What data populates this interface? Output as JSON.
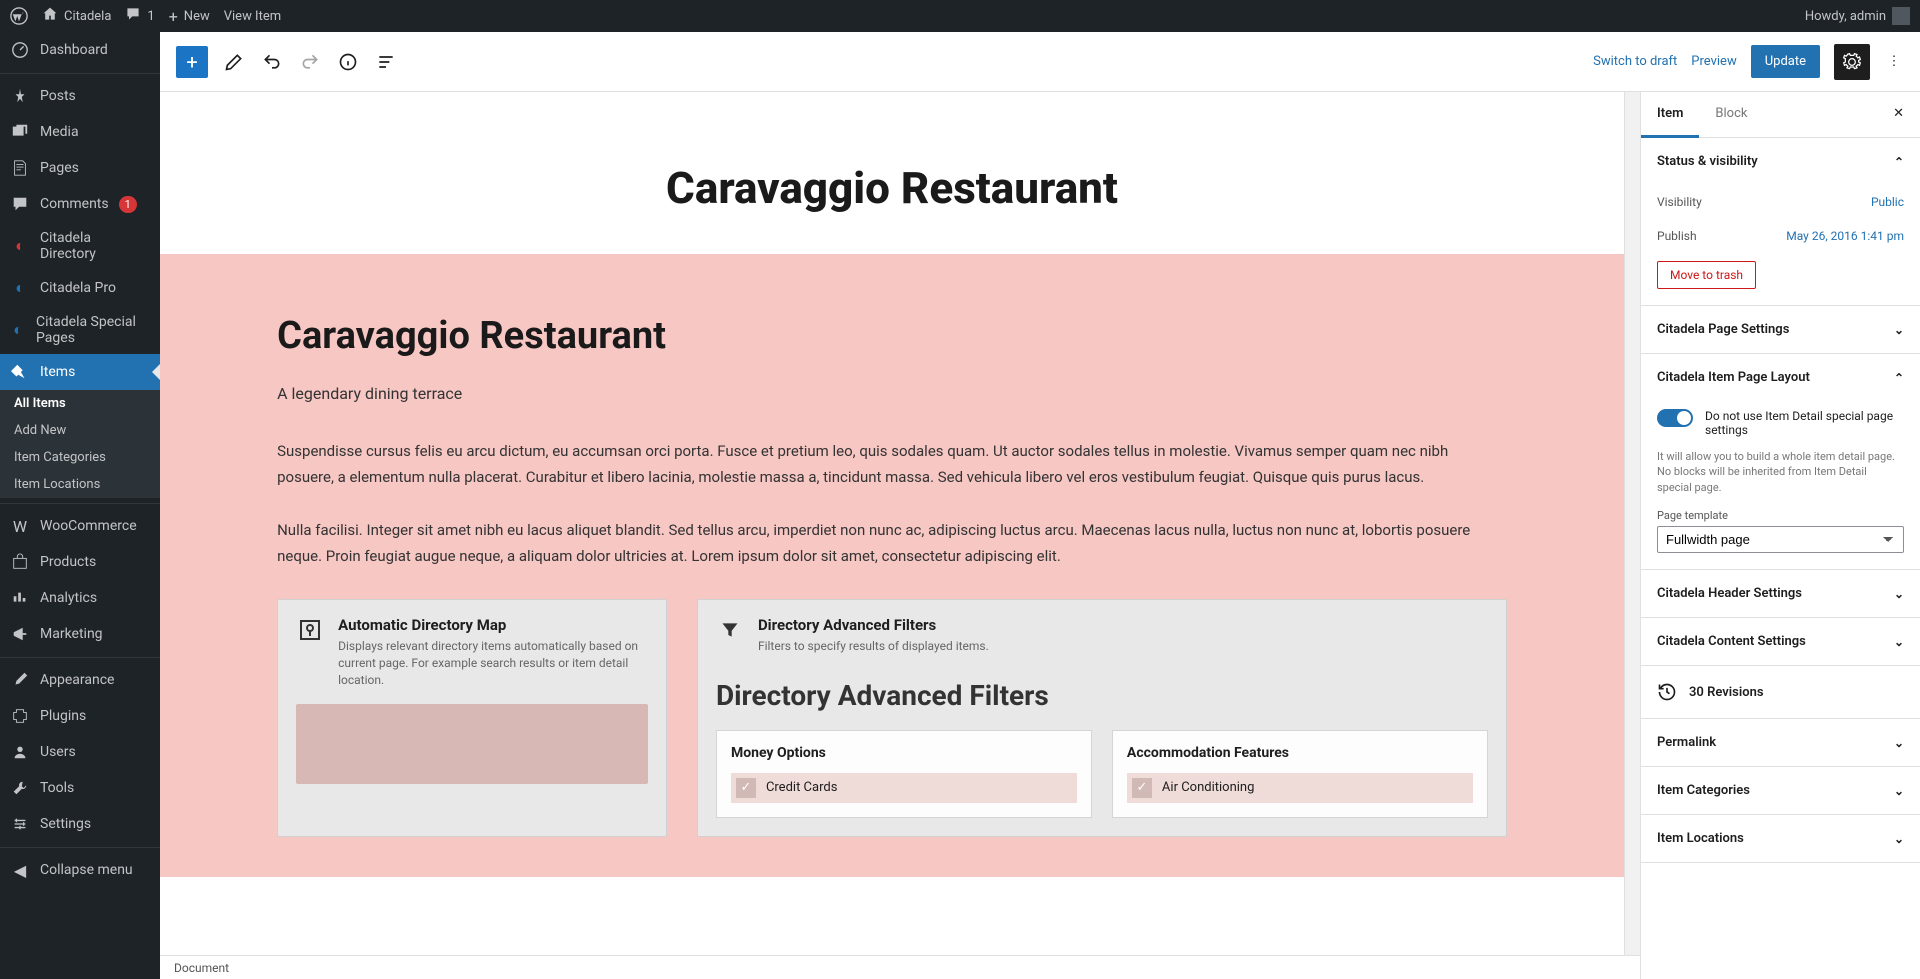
{
  "adminBar": {
    "siteName": "Citadela",
    "commentCount": "1",
    "newLabel": "New",
    "viewItem": "View Item",
    "greeting": "Howdy, admin"
  },
  "sidebar": {
    "items": [
      {
        "icon": "dashboard",
        "label": "Dashboard"
      },
      {
        "icon": "pin",
        "label": "Posts"
      },
      {
        "icon": "media",
        "label": "Media"
      },
      {
        "icon": "pages",
        "label": "Pages"
      },
      {
        "icon": "comments",
        "label": "Comments",
        "badge": "1"
      },
      {
        "icon": "citadela",
        "label": "Citadela Directory"
      },
      {
        "icon": "citadela",
        "label": "Citadela Pro"
      },
      {
        "icon": "citadela",
        "label": "Citadela Special Pages"
      },
      {
        "icon": "pin",
        "label": "Items",
        "active": true
      },
      {
        "icon": "woo",
        "label": "WooCommerce"
      },
      {
        "icon": "products",
        "label": "Products"
      },
      {
        "icon": "analytics",
        "label": "Analytics"
      },
      {
        "icon": "marketing",
        "label": "Marketing"
      },
      {
        "icon": "appearance",
        "label": "Appearance"
      },
      {
        "icon": "plugins",
        "label": "Plugins"
      },
      {
        "icon": "users",
        "label": "Users"
      },
      {
        "icon": "tools",
        "label": "Tools"
      },
      {
        "icon": "settings",
        "label": "Settings"
      },
      {
        "icon": "collapse",
        "label": "Collapse menu"
      }
    ],
    "submenu": [
      "All Items",
      "Add New",
      "Item Categories",
      "Item Locations"
    ],
    "submenuActive": 0
  },
  "topBar": {
    "switchDraft": "Switch to draft",
    "preview": "Preview",
    "update": "Update"
  },
  "content": {
    "pageTitle": "Caravaggio Restaurant",
    "heading": "Caravaggio Restaurant",
    "subtitle": "A legendary dining terrace",
    "para1": "Suspendisse cursus felis eu arcu dictum, eu accumsan orci porta. Fusce et pretium leo, quis sodales quam. Ut auctor sodales tellus in molestie. Vivamus semper quam nec nibh posuere, a elementum nulla placerat. Curabitur et libero lacinia, molestie massa a, tincidunt massa. Sed vehicula libero vel eros vestibulum feugiat. Quisque quis purus lacus.",
    "para2": "Nulla facilisi. Integer sit amet nibh eu lacus aliquet blandit. Sed tellus arcu, imperdiet non nunc ac, adipiscing luctus arcu. Maecenas lacus nulla, luctus non nunc at, lobortis posuere neque. Proin feugiat augue neque, a aliquam dolor ultricies at. Lorem ipsum dolor sit amet, consectetur adipiscing elit.",
    "block1": {
      "title": "Automatic Directory Map",
      "desc": "Displays relevant directory items automatically based on current page. For example search results or item detail location."
    },
    "block2": {
      "title": "Directory Advanced Filters",
      "desc": "Filters to specify results of displayed items.",
      "heading": "Directory Advanced Filters",
      "group1": {
        "title": "Money Options",
        "opt1": "Credit Cards"
      },
      "group2": {
        "title": "Accommodation Features",
        "opt1": "Air Conditioning"
      }
    }
  },
  "inspector": {
    "tabItem": "Item",
    "tabBlock": "Block",
    "statusVis": "Status & visibility",
    "visibilityLabel": "Visibility",
    "visibilityValue": "Public",
    "publishLabel": "Publish",
    "publishValue": "May 26, 2016 1:41 pm",
    "trash": "Move to trash",
    "pageSettings": "Citadela Page Settings",
    "itemLayout": "Citadela Item Page Layout",
    "toggleLabel": "Do not use Item Detail special page settings",
    "toggleHelp": "It will allow you to build a whole item detail page. No blocks will be inherited from Item Detail special page.",
    "templateLabel": "Page template",
    "templateValue": "Fullwidth page",
    "headerSettings": "Citadela Header Settings",
    "contentSettings": "Citadela Content Settings",
    "revisions": "30 Revisions",
    "permalink": "Permalink",
    "itemCategories": "Item Categories",
    "itemLocations": "Item Locations"
  },
  "footer": {
    "status": "Document"
  }
}
